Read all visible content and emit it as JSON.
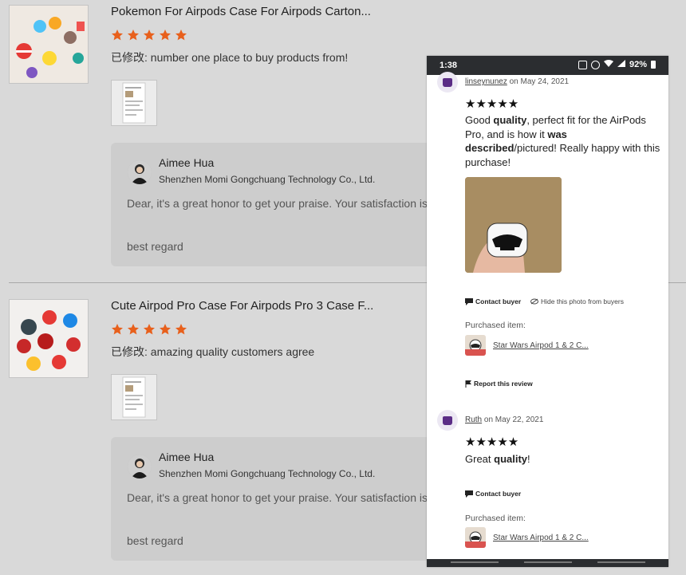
{
  "reviews": [
    {
      "title": "Pokemon For Airpods Case For Airpods Carton...",
      "comment": "已修改: number one place to buy products from!",
      "reply": {
        "name": "Aimee Hua",
        "company": "Shenzhen Momi Gongchuang Technology Co., Ltd.",
        "text": "Dear, it's a great honor to get your praise. Your satisfaction is o",
        "sign": "best  regard"
      }
    },
    {
      "title": "Cute Airpod Pro Case For Airpods Pro 3 Case F...",
      "comment": "已修改: amazing quality customers agree",
      "reply": {
        "name": "Aimee Hua",
        "company": "Shenzhen Momi Gongchuang Technology Co., Ltd.",
        "text": "Dear, it's a great honor to get your praise. Your satisfaction is o",
        "sign": "best  regard"
      }
    }
  ],
  "star_color": "#e8601c",
  "rating_stars": 5,
  "phone": {
    "status": {
      "time": "1:38",
      "battery": "92%"
    },
    "reviews": [
      {
        "user": "linseynunez",
        "date_text": " on May 24, 2021",
        "stars": "★★★★★",
        "text_parts": [
          "Good ",
          "quality",
          ", perfect fit for the AirPods Pro, and is how it ",
          "was described",
          "/pictured! Really happy with this purchase!"
        ],
        "contact": "Contact buyer",
        "hide_photo": "Hide this photo from buyers",
        "purchased_label": "Purchased item:",
        "item": "Star Wars Airpod 1 & 2 C...",
        "report": "Report this review"
      },
      {
        "user": "Ruth",
        "date_text": " on May 22, 2021",
        "stars": "★★★★★",
        "text_parts": [
          "Great ",
          "quality",
          "!"
        ],
        "contact": "Contact buyer",
        "purchased_label": "Purchased item:",
        "item": "Star Wars Airpod 1 & 2 C..."
      }
    ]
  }
}
